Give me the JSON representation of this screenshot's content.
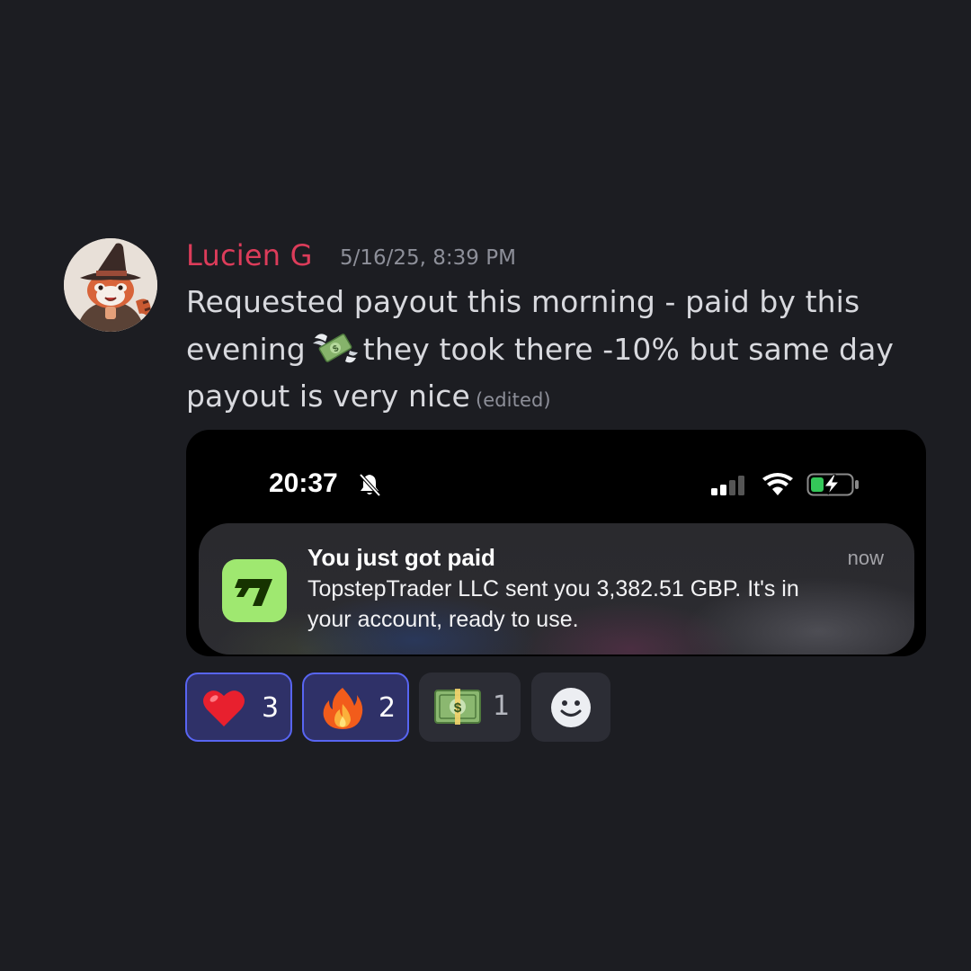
{
  "message": {
    "author": "Lucien G",
    "timestamp": "5/16/25, 8:39 PM",
    "text_lines": [
      "Requested payout this morning - paid by this",
      "evening",
      "they took there -10% but same day",
      "payout is very nice"
    ],
    "inline_emoji": "money-with-wings-icon",
    "edited_label": "(edited)",
    "author_color": "#dc3c5a",
    "avatar_icon": "red-panda-witch-avatar"
  },
  "attachment": {
    "status_bar": {
      "time": "20:37",
      "icons": [
        "bell-off-icon",
        "signal-icon",
        "wifi-icon",
        "battery-charging-icon"
      ]
    },
    "notification": {
      "app_icon": "wise-app-icon",
      "app_icon_color": "#9fe870",
      "title": "You just got paid",
      "time": "now",
      "body_lines": [
        "TopstepTrader LLC sent you 3,382.51 GBP. It's in",
        "your account, ready to use."
      ]
    }
  },
  "reactions": [
    {
      "emoji": "heart-icon",
      "count": "3",
      "active": true
    },
    {
      "emoji": "fire-icon",
      "count": "2",
      "active": true
    },
    {
      "emoji": "dollar-banknote-icon",
      "count": "1",
      "active": false
    }
  ],
  "add_reaction": {
    "icon": "smile-icon"
  },
  "colors": {
    "background": "#1c1d22",
    "active_reaction_border": "#5865f2",
    "active_reaction_bg": "#2f3168"
  }
}
